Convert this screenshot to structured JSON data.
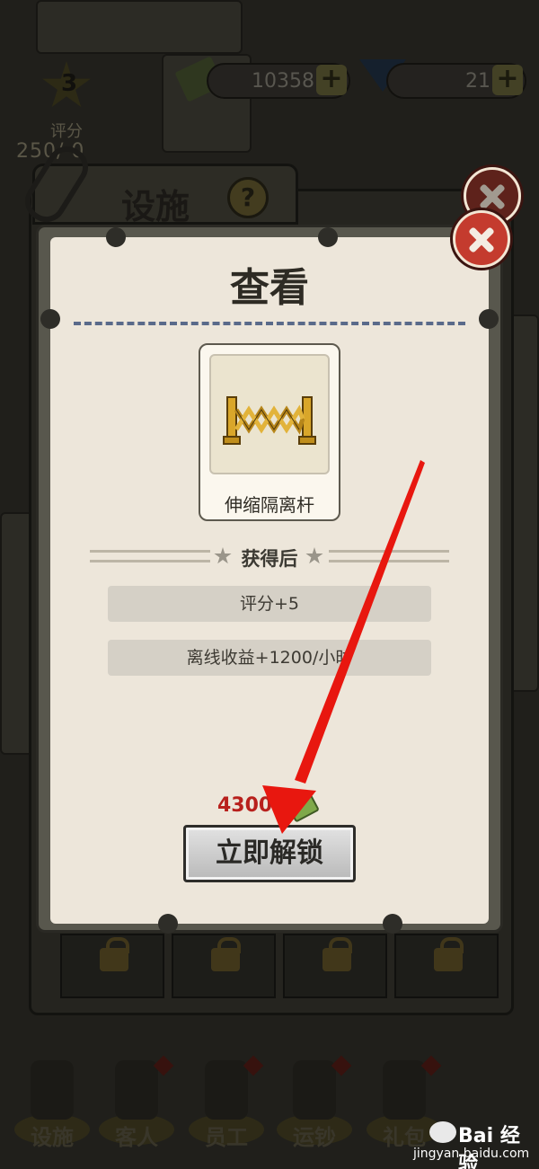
{
  "hud": {
    "cash_value": "10358",
    "gem_value": "21",
    "plus_label": "+",
    "rating_level": "3",
    "rating_label": "评分",
    "rating_progress": "250/  0"
  },
  "facility_panel": {
    "title": "设施",
    "help_label": "?"
  },
  "dialog": {
    "title": "查看",
    "item_name": "伸缩隔离杆",
    "section_label": "获得后",
    "benefits": [
      {
        "text": "评分+5"
      },
      {
        "text": "离线收益+1200/小时"
      }
    ],
    "price": "4300",
    "unlock_label": "立即解锁"
  },
  "bottom_nav": [
    {
      "label": "设施"
    },
    {
      "label": "客人"
    },
    {
      "label": "员工"
    },
    {
      "label": "运钞"
    },
    {
      "label": "礼包"
    }
  ],
  "watermark": {
    "brand": "Bai 经验",
    "url": "jingyan.baidu.com"
  },
  "colors": {
    "accent_red": "#d42a1e",
    "close_red": "#c43b2e",
    "price_red": "#b8201c",
    "paper": "#ede6da",
    "dash_blue": "#5a6a8a"
  }
}
